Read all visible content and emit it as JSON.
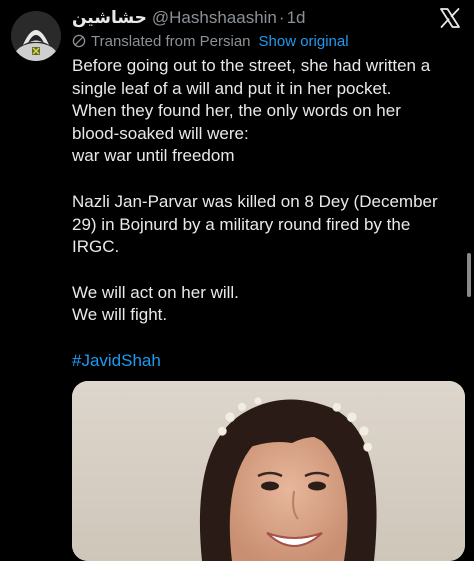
{
  "tweet": {
    "display_name": "حشاشین",
    "handle": "@Hashshaashin",
    "separator": "·",
    "time": "1d",
    "translated_label": "Translated from Persian",
    "show_original": "Show original",
    "paragraphs": [
      [
        "Before going out to the street, she had written a",
        "single leaf of a will and put it in her pocket.",
        "When they found her, the only words on her",
        "blood-soaked will were:",
        "war war until freedom"
      ],
      [
        "Nazli Jan-Parvar was killed on 8 Dey (December",
        "29) in Bojnurd by a military round fired by the",
        "IRGC."
      ],
      [
        "We will act on her will.",
        "We will fight."
      ]
    ],
    "hashtag": "#JavidShah"
  },
  "icons": {
    "avatar": "assassin-hood-avatar",
    "platform": "x-logo-icon",
    "translate": "translate-icon"
  },
  "colors": {
    "background": "#000000",
    "text": "#e7e9ea",
    "muted": "#8b9196",
    "link": "#1d9bf0"
  }
}
